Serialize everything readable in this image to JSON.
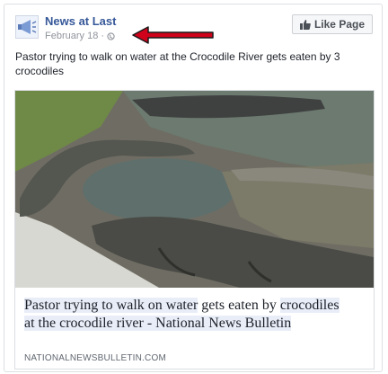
{
  "post": {
    "page_name": "News at Last",
    "date": "February 18",
    "separator": "·",
    "privacy_icon": "globe-icon",
    "like_page_icon": "thumbs-up-icon",
    "like_page_label": "Like Page",
    "text": "Pastor trying to walk on water at the Crocodile River gets eaten by 3 crocodiles"
  },
  "annotation": {
    "icon": "red-arrow-icon",
    "color": "#d0021b"
  },
  "link_preview": {
    "image_description_icon": "crocodiles-photo",
    "title_part_1": "Pastor trying to walk on water",
    "title_part_2": " gets eaten by ",
    "title_part_3": "crocodiles at the crocodile river - National News Bulletin",
    "domain": "NATIONALNEWSBULLETIN.COM"
  },
  "colors": {
    "link_blue": "#365899",
    "meta_gray": "#90949c",
    "border": "#dddfe2"
  }
}
